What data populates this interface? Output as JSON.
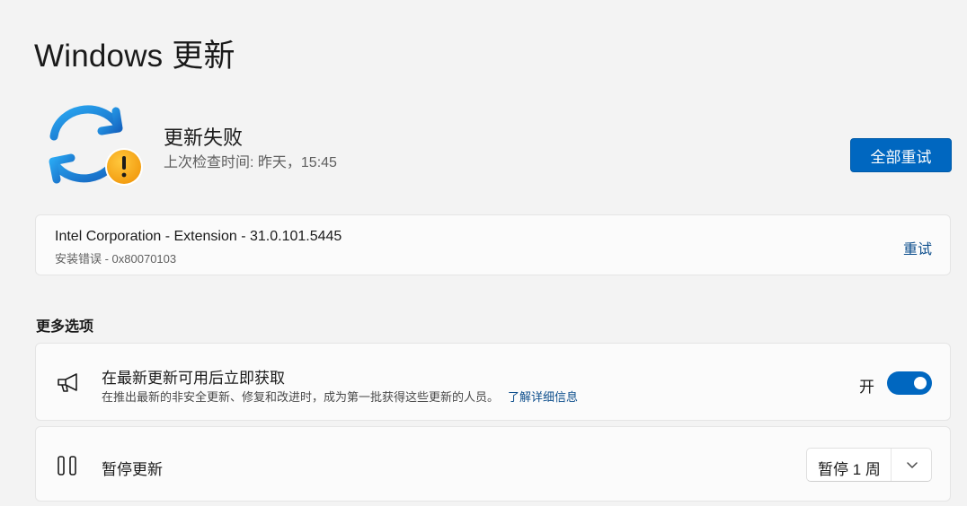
{
  "page": {
    "title": "Windows 更新"
  },
  "status": {
    "title": "更新失败",
    "subtitle": "上次检查时间: 昨天，15:45",
    "icon": "sync-warning-icon",
    "warning_color": "#f7a51c",
    "sync_color": "#1c8fe0"
  },
  "actions": {
    "retry_all_label": "全部重试"
  },
  "failed_update": {
    "name": "Intel Corporation - Extension - 31.0.101.5445",
    "error": "安装错误 - 0x80070103",
    "retry_label": "重试"
  },
  "more_options": {
    "header": "更多选项",
    "get_latest": {
      "icon": "megaphone-icon",
      "title": "在最新更新可用后立即获取",
      "description": "在推出最新的非安全更新、修复和改进时，成为第一批获得这些更新的人员。",
      "link": "了解详细信息",
      "toggle_label": "开",
      "toggle_on": true
    },
    "pause": {
      "icon": "pause-icon",
      "title": "暂停更新",
      "selected": "暂停 1 周"
    }
  },
  "colors": {
    "accent": "#0067c0",
    "link": "#0e4f8d"
  }
}
